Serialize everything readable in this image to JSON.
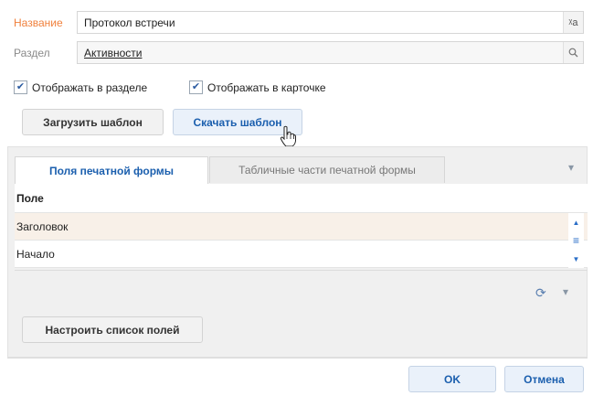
{
  "form": {
    "name_label": "Название",
    "name_value": "Протокол встречи",
    "name_icon": "ᵡa",
    "section_label": "Раздел",
    "section_value": "Активности",
    "section_icon": "🔍"
  },
  "checkboxes": {
    "show_in_section": "Отображать в разделе",
    "show_in_card": "Отображать в карточке"
  },
  "buttons": {
    "upload_template": "Загрузить шаблон",
    "download_template": "Скачать шаблон",
    "configure_fields": "Настроить список полей",
    "ok": "OK",
    "cancel": "Отмена"
  },
  "tabs": {
    "print_form_fields": "Поля печатной формы",
    "print_form_tables": "Табличные части печатной формы"
  },
  "grid": {
    "header": "Поле",
    "rows": [
      "Заголовок",
      "Начало"
    ]
  },
  "icons": {
    "refresh": "⟳",
    "filter": "▾",
    "scroll_up": "▲",
    "scroll_mid": "≡",
    "scroll_down": "▼",
    "tabs_menu": "▾"
  },
  "colors": {
    "accent_blue": "#1b5fae",
    "label_orange": "#f0803c"
  }
}
